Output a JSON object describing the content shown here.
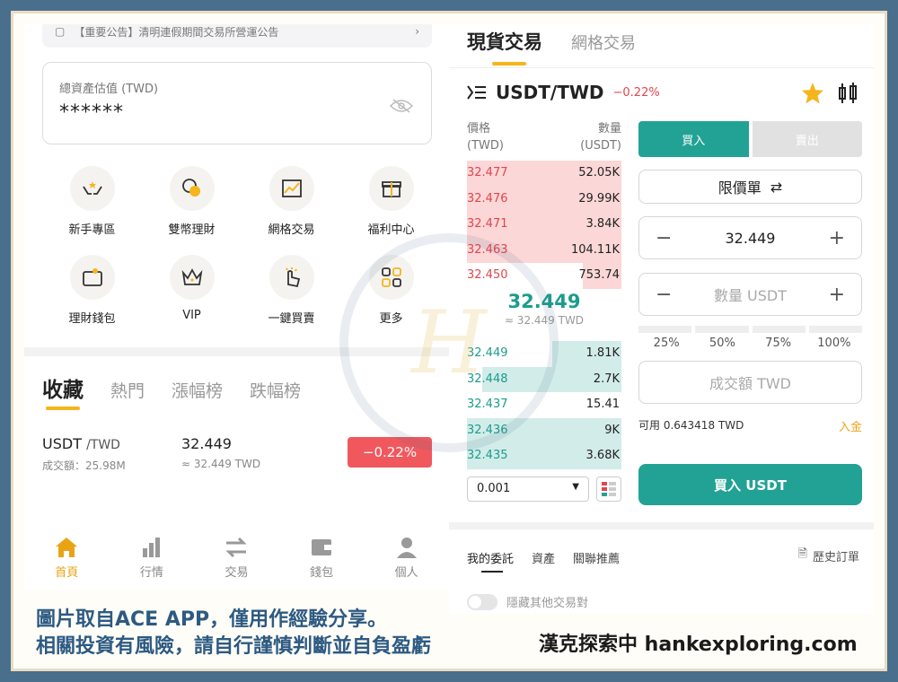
{
  "left": {
    "announcement": "【重要公告】清明連假期間交易所營運公告",
    "asset": {
      "label": "總資產估值 (TWD)",
      "value": "******"
    },
    "grid": [
      {
        "label": "新手專區"
      },
      {
        "label": "雙幣理財"
      },
      {
        "label": "網格交易"
      },
      {
        "label": "福利中心"
      },
      {
        "label": "理財錢包"
      },
      {
        "label": "VIP"
      },
      {
        "label": "一鍵買賣"
      },
      {
        "label": "更多"
      }
    ],
    "tabs": [
      "收藏",
      "熱門",
      "漲幅榜",
      "跌幅榜"
    ],
    "fav": {
      "base": "USDT",
      "quote": "/TWD",
      "volume": "成交額：25.98M",
      "price": "32.449",
      "price_twd": "≈ 32.449 TWD",
      "change": "−0.22%"
    },
    "nav": [
      "首頁",
      "行情",
      "交易",
      "錢包",
      "個人"
    ]
  },
  "right": {
    "tabs": [
      "現貨交易",
      "網格交易"
    ],
    "pair": "USDT/TWD",
    "change": "−0.22%",
    "ob_head": {
      "price": "價格",
      "price_unit": "(TWD)",
      "qty": "數量",
      "qty_unit": "(USDT)"
    },
    "asks": [
      {
        "p": "32.477",
        "a": "52.05K"
      },
      {
        "p": "32.476",
        "a": "29.99K"
      },
      {
        "p": "32.471",
        "a": "3.84K"
      },
      {
        "p": "32.463",
        "a": "104.11K"
      },
      {
        "p": "32.450",
        "a": "753.74"
      }
    ],
    "mid": {
      "price": "32.449",
      "twd": "≈ 32.449 TWD"
    },
    "bids": [
      {
        "p": "32.449",
        "a": "1.81K"
      },
      {
        "p": "32.448",
        "a": "2.7K"
      },
      {
        "p": "32.437",
        "a": "15.41"
      },
      {
        "p": "32.436",
        "a": "9K"
      },
      {
        "p": "32.435",
        "a": "3.68K"
      }
    ],
    "depth": "0.001",
    "buy_tab": "買入",
    "sell_tab": "賣出",
    "order_type": "限價單",
    "price_value": "32.449",
    "qty_placeholder": "數量 USDT",
    "pcts": [
      "25%",
      "50%",
      "75%",
      "100%"
    ],
    "total_placeholder": "成交額 TWD",
    "available": "可用 0.643418 TWD",
    "deposit": "入金",
    "buy_button": "買入 USDT",
    "bottom_tabs": [
      "我的委託",
      "資產",
      "關聯推薦"
    ],
    "history": "歷史訂單",
    "hide_toggle": "隱藏其他交易對"
  },
  "caption": {
    "line1": "圖片取自ACE APP，僅用作經驗分享。",
    "line2": "相關投資有風險，請自行謹慎判斷並自負盈虧",
    "brand": "漢克探索中 hankexploring.com"
  },
  "colors": {
    "teal": "#22a294",
    "red": "#e0464d",
    "gold": "#f5b51b",
    "frame": "#4a6f8c"
  }
}
